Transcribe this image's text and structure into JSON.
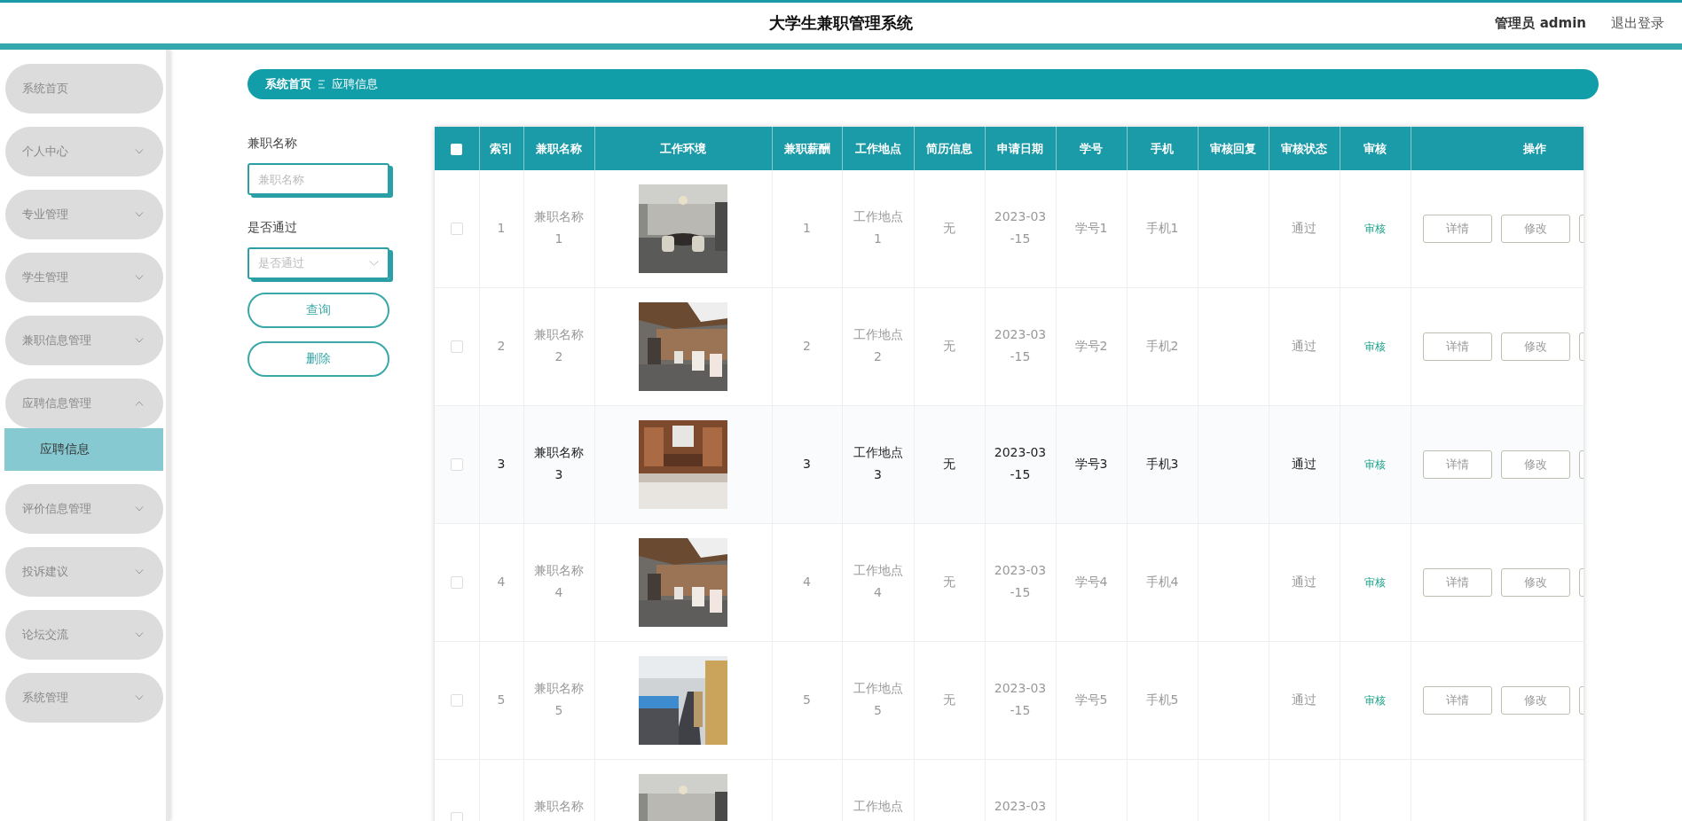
{
  "header": {
    "title": "大学生兼职管理系统",
    "user": "管理员 admin",
    "logout": "退出登录"
  },
  "sidebar": {
    "items": [
      {
        "label": "系统首页",
        "kind": "link"
      },
      {
        "label": "个人中心",
        "kind": "menu",
        "expanded": false
      },
      {
        "label": "专业管理",
        "kind": "menu",
        "expanded": false
      },
      {
        "label": "学生管理",
        "kind": "menu",
        "expanded": false
      },
      {
        "label": "兼职信息管理",
        "kind": "menu",
        "expanded": false
      },
      {
        "label": "应聘信息管理",
        "kind": "menu",
        "expanded": true,
        "children": [
          {
            "label": "应聘信息",
            "selected": true
          }
        ]
      },
      {
        "label": "评价信息管理",
        "kind": "menu",
        "expanded": false
      },
      {
        "label": "投诉建议",
        "kind": "menu",
        "expanded": false
      },
      {
        "label": "论坛交流",
        "kind": "menu",
        "expanded": false
      },
      {
        "label": "系统管理",
        "kind": "menu",
        "expanded": false
      }
    ]
  },
  "breadcrumb": [
    "系统首页",
    "应聘信息"
  ],
  "filters": {
    "fields": [
      {
        "label": "兼职名称",
        "kind": "text",
        "placeholder": "兼职名称"
      },
      {
        "label": "是否通过",
        "kind": "select",
        "placeholder": "是否通过"
      }
    ],
    "buttons": [
      "查询",
      "删除"
    ]
  },
  "table": {
    "select_all": {
      "checked": false
    },
    "columns": [
      "索引",
      "兼职名称",
      "工作环境",
      "兼职薪酬",
      "工作地点",
      "简历信息",
      "申请日期",
      "学号",
      "手机",
      "审核回复",
      "审核状态",
      "审核",
      "操作"
    ],
    "rows": [
      {
        "checked": false,
        "hovered": false,
        "index": "1",
        "name": "兼职名称 1",
        "pay": "1",
        "place": "工作地点 1",
        "resume": "无",
        "date": "2023-03 -15",
        "student_no": "学号1",
        "phone": "手机1",
        "status": "通过",
        "review": "审核",
        "actions": [
          "详情",
          "修改"
        ]
      },
      {
        "checked": false,
        "hovered": false,
        "index": "2",
        "name": "兼职名称 2",
        "pay": "2",
        "place": "工作地点 2",
        "resume": "无",
        "date": "2023-03 -15",
        "student_no": "学号2",
        "phone": "手机2",
        "status": "通过",
        "review": "审核",
        "actions": [
          "详情",
          "修改"
        ]
      },
      {
        "checked": false,
        "hovered": true,
        "index": "3",
        "name": "兼职名称 3",
        "pay": "3",
        "place": "工作地点 3",
        "resume": "无",
        "date": "2023-03 -15",
        "student_no": "学号3",
        "phone": "手机3",
        "status": "通过",
        "review": "审核",
        "actions": [
          "详情",
          "修改"
        ]
      },
      {
        "checked": false,
        "hovered": false,
        "index": "4",
        "name": "兼职名称 4",
        "pay": "4",
        "place": "工作地点 4",
        "resume": "无",
        "date": "2023-03 -15",
        "student_no": "学号4",
        "phone": "手机4",
        "status": "通过",
        "review": "审核",
        "actions": [
          "详情",
          "修改"
        ]
      },
      {
        "checked": false,
        "hovered": false,
        "index": "5",
        "name": "兼职名称 5",
        "pay": "5",
        "place": "工作地点 5",
        "resume": "无",
        "date": "2023-03 -15",
        "student_no": "学号5",
        "phone": "手机5",
        "status": "通过",
        "review": "审核",
        "actions": [
          "详情",
          "修改"
        ]
      },
      {
        "checked": false,
        "hovered": false,
        "name": "兼职名称",
        "place": "工作地点",
        "date": "2023-03"
      }
    ]
  }
}
